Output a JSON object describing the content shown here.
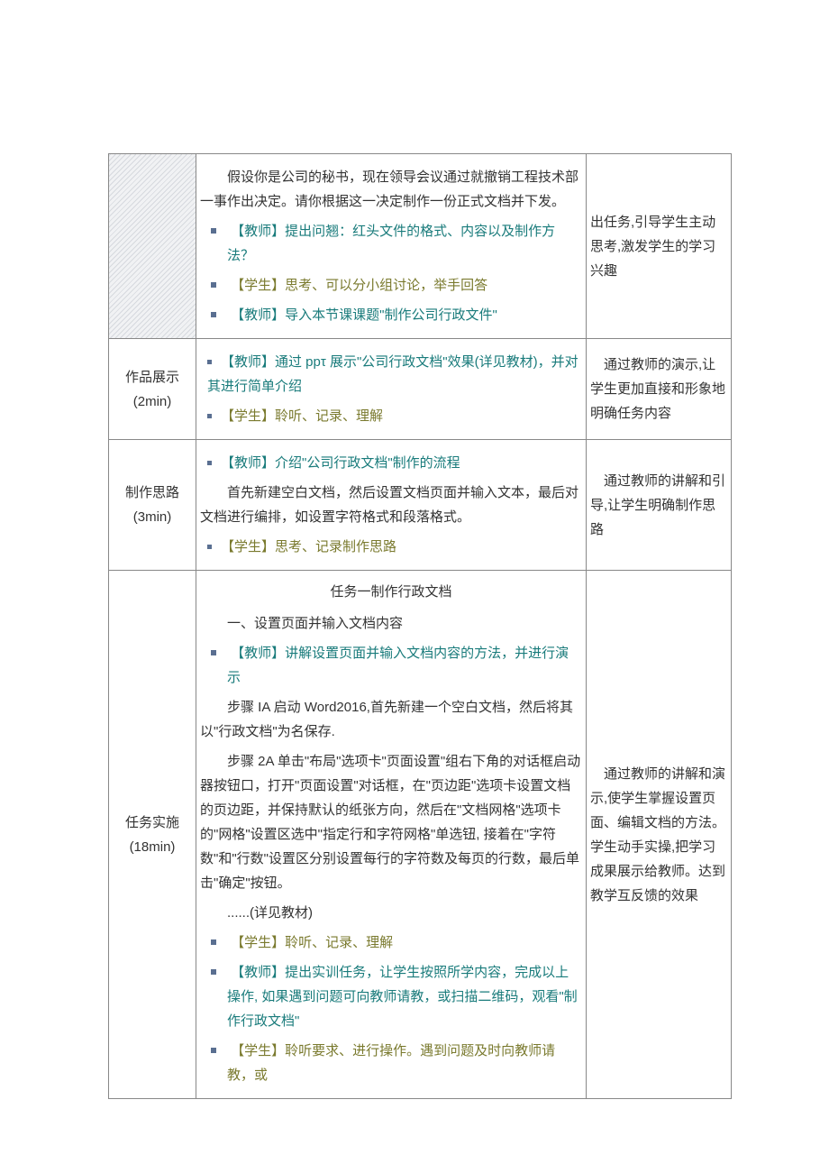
{
  "rows": [
    {
      "mid": {
        "intro_indent": "假设你是公司的秘书，现在领导会议通过就撤销工程技术部一事作出决定。请你根据这一决定制作一份正式文档并下发。",
        "items": [
          {
            "text": "【教师】提出问翘：红头文件的格式、内容以及制作方法？",
            "cls": "teal"
          },
          {
            "text": "【学生】思考、可以分小组讨论，举手回答",
            "cls": "olive"
          },
          {
            "text": "【教师】导入本节课课题\"制作公司行政文件\"",
            "cls": "teal"
          }
        ]
      },
      "right": "出任务,引导学生主动思考,激发学生的学习兴趣"
    },
    {
      "left": {
        "line1": "作品展示",
        "line2": "(2min)"
      },
      "mid": {
        "bullets": [
          {
            "text": "【教师】通过 ppτ 展示\"公司行政文档\"效果(详见教材)，并对其进行简单介绍",
            "cls": "teal",
            "wrapIndent": true
          },
          {
            "text": "【学生】聆听、记录、理解",
            "cls": "olive"
          }
        ]
      },
      "right": "通过教师的演示,让学生更加直接和形象地明确任务内容"
    },
    {
      "left": {
        "line1": "制作思路",
        "line2": "(3min)"
      },
      "mid": {
        "top": {
          "text": "【教师】介绍\"公司行政文档\"制作的流程",
          "cls": "teal"
        },
        "para": "首先新建空白文档，然后设置文档页面并输入文本，最后对文档进行编排，如设置字符格式和段落格式。",
        "bottom": {
          "text": "【学生】思考、记录制作思路",
          "cls": "olive"
        }
      },
      "right": "通过教师的讲解和引导,让学生明确制作思路"
    },
    {
      "left": {
        "line1": "任务实施",
        "line2": "(18min)"
      },
      "mid": {
        "title": "任务一制作行政文档",
        "sub": "一、设置页面并输入文档内容",
        "b1": {
          "text": "【教师】讲解设置页面并输入文档内容的方法，并进行演示",
          "cls": "teal"
        },
        "p1": "步骤 IA 启动 Word2016,首先新建一个空白文档，然后将其以\"行政文档\"为名保存.",
        "p2": "步骤 2A 单击\"布局\"选项卡\"页面设置\"组右下角的对话框启动器按钮口，打开\"页面设置\"对话框，在\"页边距\"选项卡设置文档的页边距，并保持默认的纸张方向，然后在\"文档网格\"选项卡的\"网格\"设置区选中\"指定行和字符网格\"单选钮, 接着在\"字符数\"和\"行数\"设置区分别设置每行的字符数及每页的行数，最后单击\"确定\"按钮。",
        "p3": "......(详见教材)",
        "b2": {
          "text": "【学生】聆听、记录、理解",
          "cls": "olive"
        },
        "b3": {
          "text": "【教师】提出实训任务，让学生按照所学内容，完成以上操作, 如果遇到问题可向教师请教，或扫描二维码，观看\"制作行政文档\"",
          "cls": "teal"
        },
        "b4": {
          "text": "【学生】聆听要求、进行操作。遇到问题及时向教师请教，或",
          "cls": "olive"
        }
      },
      "right": "通过教师的讲解和演示,使学生掌握设置页面、编辑文档的方法。学生动手实操,把学习成果展示给教师。达到教学互反馈的效果"
    }
  ]
}
